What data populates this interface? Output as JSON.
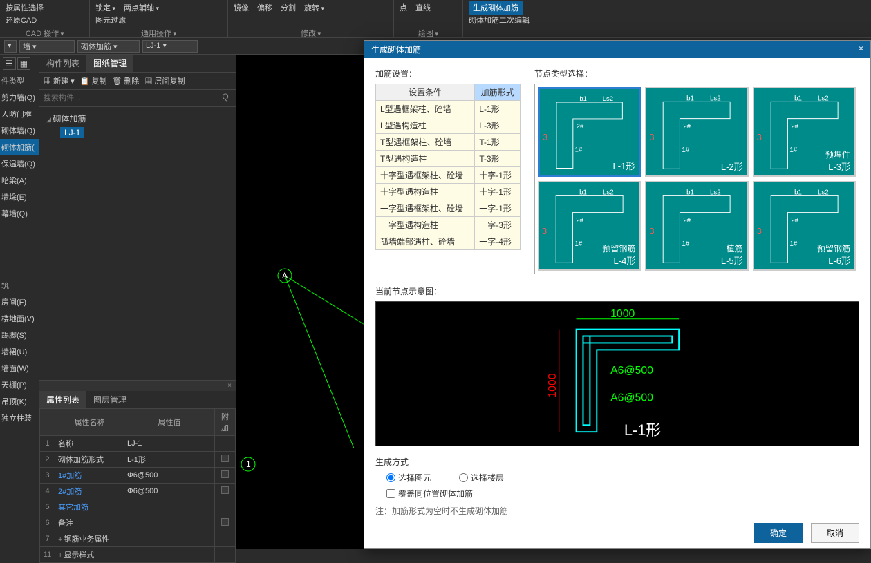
{
  "ribbon": {
    "groups": [
      {
        "items_row1": [
          "按属性选择"
        ],
        "items_row2": [
          "还原CAD"
        ],
        "label": "CAD 操作"
      },
      {
        "items_row1": [
          "锁定",
          "两点辅轴"
        ],
        "items_row2": [
          "图元过滤"
        ],
        "label": "通用操作"
      },
      {
        "items_row1": [
          "镜像",
          "偏移",
          "分割",
          "旋转"
        ],
        "items_row2": [],
        "label": "修改"
      },
      {
        "items_row1": [
          "点",
          "直线"
        ],
        "items_row2": [],
        "label": "绘图"
      },
      {
        "items_row1_hl": "生成砌体加筋",
        "items_row2": [
          "砌体加筋二次编辑"
        ],
        "label": ""
      }
    ]
  },
  "secondary": {
    "sel1": "",
    "sel2": "墙",
    "sel3": "砌体加筋",
    "sel4": "LJ-1"
  },
  "left": {
    "header": "件类型",
    "items": [
      "剪力墙(Q)",
      "人防门框",
      "砌体墙(Q)",
      "砌体加筋(",
      "保温墙(Q)",
      "暗梁(A)",
      "墙垛(E)",
      "幕墙(Q)"
    ],
    "selected_idx": 3,
    "items2_header": "筑",
    "items2": [
      "房间(F)",
      "楼地面(V)",
      "踢脚(S)",
      "墙裙(U)",
      "墙面(W)",
      "天棚(P)",
      "吊顶(K)",
      "独立柱装"
    ]
  },
  "comp_panel": {
    "tabs": [
      "构件列表",
      "图纸管理"
    ],
    "active_tab": 0,
    "toolbar": [
      "新建",
      "复制",
      "删除",
      "层间复制"
    ],
    "search_placeholder": "搜索构件...",
    "tree": {
      "parent": "砌体加筋",
      "leaf": "LJ-1"
    }
  },
  "prop_panel": {
    "tabs": [
      "属性列表",
      "图层管理"
    ],
    "active_tab": 0,
    "headers": [
      "",
      "属性名称",
      "属性值",
      "附加"
    ],
    "rows": [
      {
        "idx": "1",
        "name": "名称",
        "link": false,
        "val": "LJ-1",
        "att": false
      },
      {
        "idx": "2",
        "name": "砌体加筋形式",
        "link": false,
        "val": "L-1形",
        "att": true
      },
      {
        "idx": "3",
        "name": "1#加筋",
        "link": true,
        "val": "Φ6@500",
        "att": true
      },
      {
        "idx": "4",
        "name": "2#加筋",
        "link": true,
        "val": "Φ6@500",
        "att": true
      },
      {
        "idx": "5",
        "name": "其它加筋",
        "link": true,
        "val": "",
        "att": false
      },
      {
        "idx": "6",
        "name": "备注",
        "link": false,
        "val": "",
        "att": true
      },
      {
        "idx": "7",
        "name": "钢筋业务属性",
        "link": false,
        "expand": true,
        "val": "",
        "att": false
      },
      {
        "idx": "11",
        "name": "显示样式",
        "link": false,
        "expand": true,
        "val": "",
        "att": false
      }
    ]
  },
  "canvas": {
    "node_a": "A",
    "node_1": "1"
  },
  "modal": {
    "title": "生成砌体加筋",
    "settings_label": "加筋设置：",
    "nodes_label": "节点类型选择：",
    "settings_headers": [
      "设置条件",
      "加筋形式"
    ],
    "settings_rows": [
      [
        "L型遇框架柱、砼墙",
        "L-1形"
      ],
      [
        "L型遇构造柱",
        "L-3形"
      ],
      [
        "T型遇框架柱、砼墙",
        "T-1形"
      ],
      [
        "T型遇构造柱",
        "T-3形"
      ],
      [
        "十字型遇框架柱、砼墙",
        "十字-1形"
      ],
      [
        "十字型遇构造柱",
        "十字-1形"
      ],
      [
        "一字型遇框架柱、砼墙",
        "一字-1形"
      ],
      [
        "一字型遇构造柱",
        "一字-3形"
      ],
      [
        "孤墙端部遇柱、砼墙",
        "一字-4形"
      ]
    ],
    "node_types": [
      {
        "label": "L-1形",
        "extra": "",
        "selected": true
      },
      {
        "label": "L-2形",
        "extra": ""
      },
      {
        "label": "L-3形",
        "extra": "预埋件"
      },
      {
        "label": "L-4形",
        "extra": "预留钢筋"
      },
      {
        "label": "L-5形",
        "extra": "植筋"
      },
      {
        "label": "L-6形",
        "extra": "预留钢筋"
      }
    ],
    "preview_label": "当前节点示意图：",
    "preview": {
      "dim_h": "1000",
      "dim_v": "1000",
      "rebar1": "A6@500",
      "rebar2": "A6@500",
      "shape": "L-1形"
    },
    "gen_label": "生成方式",
    "radio1": "选择图元",
    "radio2": "选择楼层",
    "checkbox": "覆盖同位置砌体加筋",
    "note": "注：加筋形式为空时不生成砌体加筋",
    "ok": "确定",
    "cancel": "取消"
  }
}
